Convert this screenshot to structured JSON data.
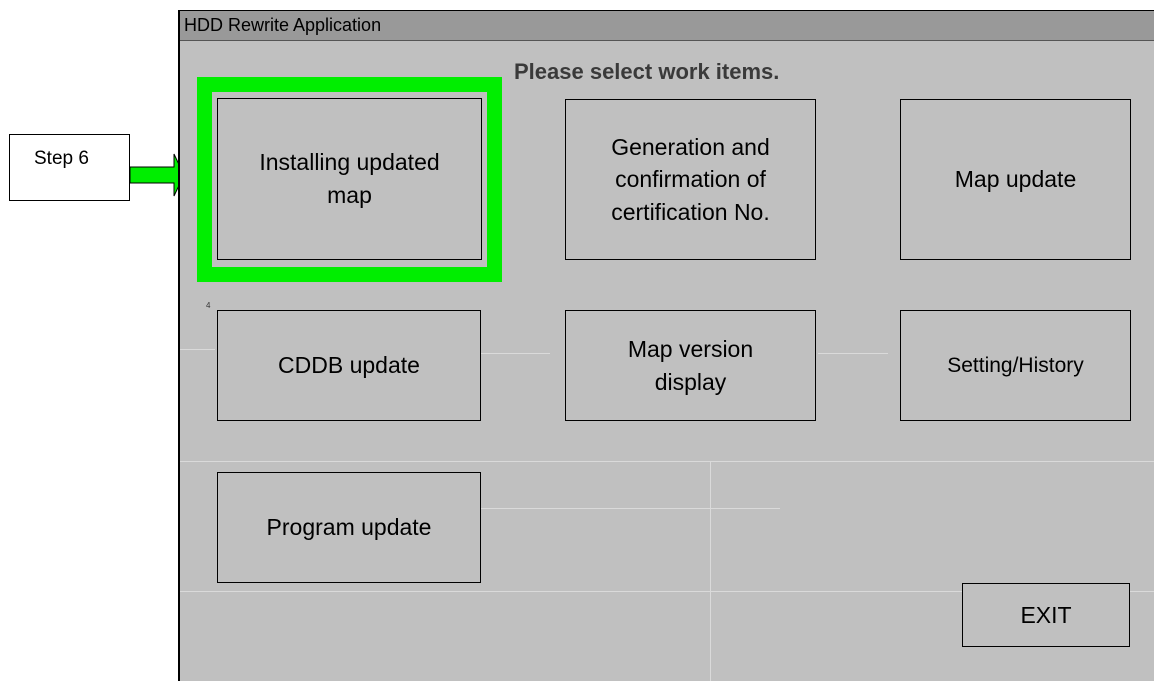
{
  "callout": {
    "label": "Step 6",
    "arrow_color": "#00ee00"
  },
  "window": {
    "title": "HDD Rewrite Application",
    "prompt": "Please select work items.",
    "page_marker": "4"
  },
  "buttons": {
    "installing_updated_map": "Installing updated\nmap",
    "generation_certification": "Generation and\nconfirmation of\ncertification No.",
    "map_update": "Map update",
    "cddb_update": "CDDB update",
    "map_version_display": "Map version\ndisplay",
    "setting_history": "Setting/History",
    "program_update": "Program update",
    "exit": "EXIT"
  },
  "highlight": {
    "target": "installing_updated_map",
    "color": "#00ee00"
  }
}
